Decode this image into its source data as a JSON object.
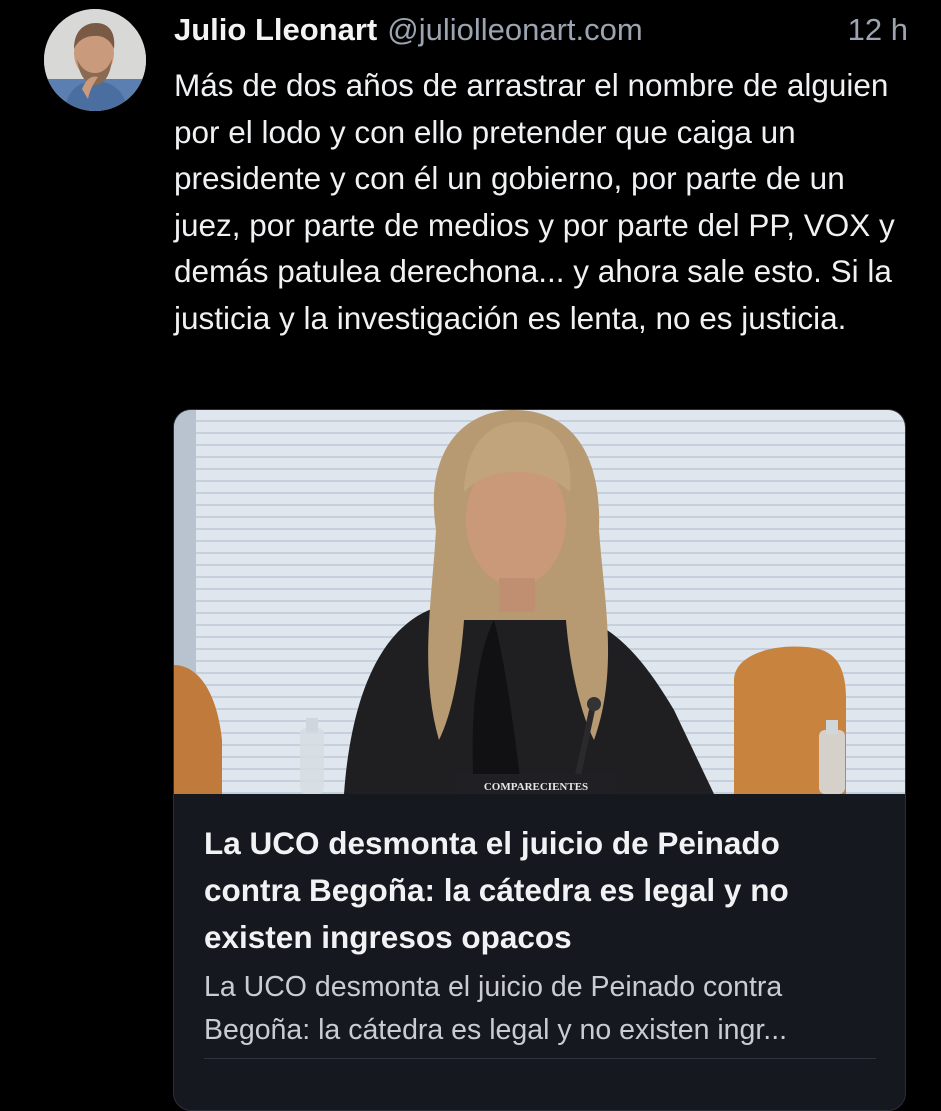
{
  "post": {
    "author_name": "Julio Lleonart",
    "handle": "@juliolleonart.com",
    "timestamp": "12 h",
    "text": "Más de dos años de arrastrar el nombre de alguien por el lodo y con ello pretender que caiga un presidente y con él un gobierno, por parte de un juez, por parte de medios y por parte del PP, VOX y demás patulea derechona... y ahora sale esto. Si la justicia y la investigación es lenta, no es justicia."
  },
  "link_card": {
    "image_caption_plaque": "COMPARECIENTES",
    "title": "La UCO desmonta el juicio de Peinado contra Begoña: la cátedra es legal y no existen ingresos opacos",
    "description": "La UCO desmonta el juicio de Peinado contra Begoña: la cátedra es legal y no existen ingr..."
  },
  "colors": {
    "background": "#000000",
    "card_background": "#15181e",
    "text_primary": "#f0f1f3",
    "text_secondary": "#9ba4b0"
  }
}
